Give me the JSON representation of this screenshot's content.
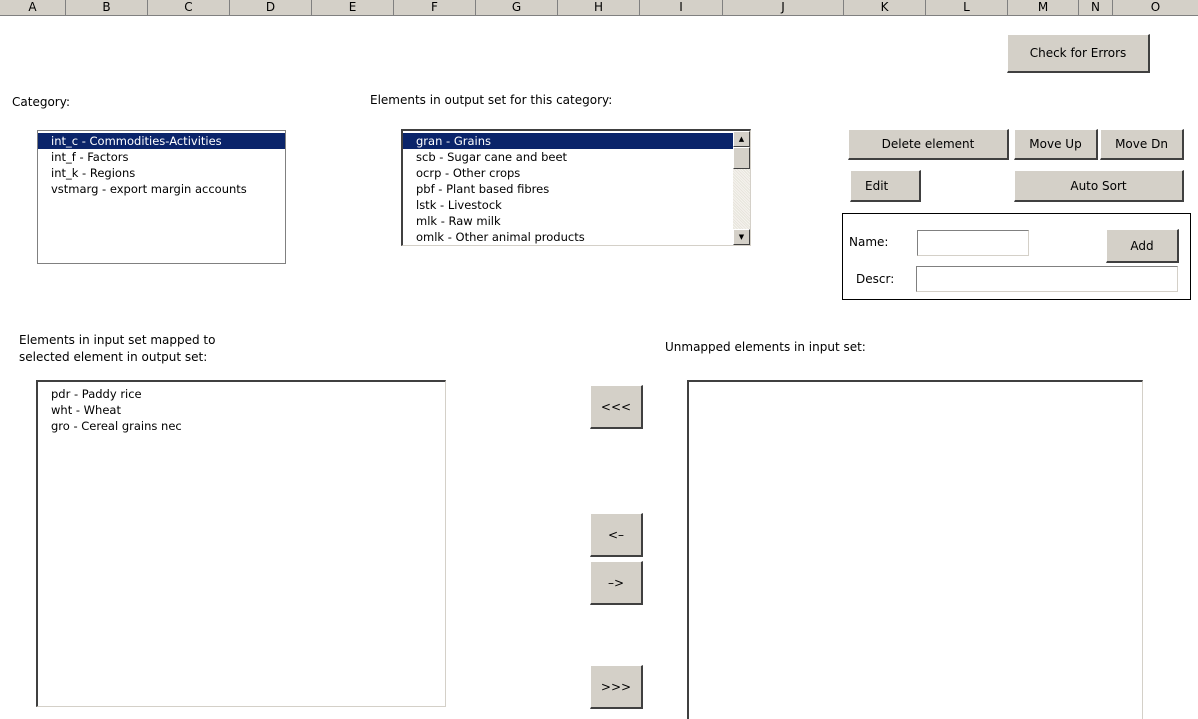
{
  "columns": [
    "A",
    "B",
    "C",
    "D",
    "E",
    "F",
    "G",
    "H",
    "I",
    "J",
    "K",
    "L",
    "M",
    "N",
    "O"
  ],
  "buttons": {
    "check_errors": "Check for Errors",
    "delete_element": "Delete element",
    "move_up": "Move Up",
    "move_dn": "Move Dn",
    "edit": "Edit",
    "auto_sort": "Auto Sort",
    "add": "Add",
    "move_all_left": "<<<",
    "move_left": "<–",
    "move_right": "–>",
    "move_all_right": ">>>"
  },
  "labels": {
    "category": "Category:",
    "output_set": "Elements in output set for this category:",
    "input_mapped_line1": "Elements in input set mapped to",
    "input_mapped_line2": "selected element in output set:",
    "unmapped": "Unmapped elements in input set:",
    "name": "Name:",
    "descr": "Descr:"
  },
  "category_list": {
    "items": [
      "int_c - Commodities-Activities",
      "int_f - Factors",
      "int_k - Regions",
      "vstmarg - export margin accounts"
    ],
    "selected": 0
  },
  "output_list": {
    "items": [
      "gran - Grains",
      "scb - Sugar cane and beet",
      "ocrp - Other crops",
      "pbf - Plant based fibres",
      "lstk - Livestock",
      "mlk - Raw milk",
      "omlk - Other animal products"
    ],
    "selected": 0
  },
  "mapped_list": {
    "items": [
      "pdr - Paddy rice",
      "wht - Wheat",
      "gro - Cereal grains nec"
    ]
  },
  "unmapped_list": {
    "items": []
  },
  "fields": {
    "name_value": "",
    "descr_value": ""
  }
}
